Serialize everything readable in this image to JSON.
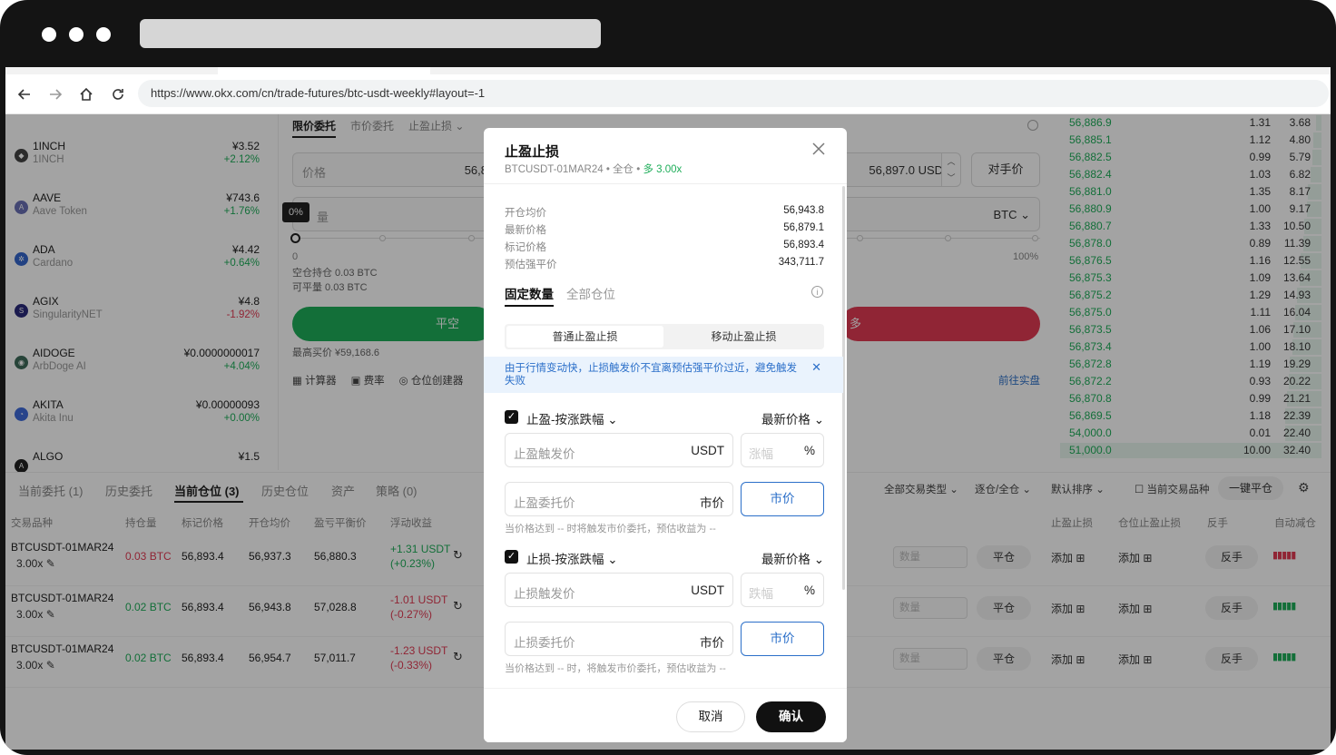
{
  "browser": {
    "url": "https://www.okx.com/cn/trade-futures/btc-usdt-weekly#layout=-1"
  },
  "coins": [
    {
      "symbol": "1INCH",
      "name": "1INCH",
      "price": "¥3.52",
      "change": "+2.12%",
      "dir": "up"
    },
    {
      "symbol": "AAVE",
      "name": "Aave Token",
      "price": "¥743.6",
      "change": "+1.76%",
      "dir": "up"
    },
    {
      "symbol": "ADA",
      "name": "Cardano",
      "price": "¥4.42",
      "change": "+0.64%",
      "dir": "up"
    },
    {
      "symbol": "AGIX",
      "name": "SingularityNET",
      "price": "¥4.8",
      "change": "-1.92%",
      "dir": "down"
    },
    {
      "symbol": "AIDOGE",
      "name": "ArbDoge AI",
      "price": "¥0.0000000017",
      "change": "+4.04%",
      "dir": "up"
    },
    {
      "symbol": "AKITA",
      "name": "Akita Inu",
      "price": "¥0.00000093",
      "change": "+0.00%",
      "dir": "up"
    },
    {
      "symbol": "ALGO",
      "name": "",
      "price": "¥1.5",
      "change": "",
      "dir": "up"
    }
  ],
  "order_panel": {
    "tabs": [
      "限价委托",
      "市价委托",
      "止盈止损"
    ],
    "price_label": "价格",
    "price_value": "56,8",
    "price_right": "56,897.0  USDT",
    "counterparty_btn": "对手价",
    "qty_label": "量",
    "qty_unit": "BTC",
    "slider_tip": "0%",
    "slider_min": "0",
    "slider_max": "100%",
    "avail_open": "空仓持仓 0.03 BTC",
    "avail_close": "可平量 0.03 BTC",
    "close_short_btn": "平空",
    "close_long_btn": "多",
    "max_buy": "最高买价 ¥59,168.6",
    "tools": [
      "计算器",
      "费率",
      "仓位创建器"
    ],
    "goto_live": "前往实盘"
  },
  "order_book": [
    {
      "price": "56,886.9",
      "qty": "1.31",
      "total": "3.68",
      "fill": 0.11
    },
    {
      "price": "56,885.1",
      "qty": "1.12",
      "total": "4.80",
      "fill": 0.15
    },
    {
      "price": "56,882.5",
      "qty": "0.99",
      "total": "5.79",
      "fill": 0.18
    },
    {
      "price": "56,882.4",
      "qty": "1.03",
      "total": "6.82",
      "fill": 0.21
    },
    {
      "price": "56,881.0",
      "qty": "1.35",
      "total": "8.17",
      "fill": 0.25
    },
    {
      "price": "56,880.9",
      "qty": "1.00",
      "total": "9.17",
      "fill": 0.28
    },
    {
      "price": "56,880.7",
      "qty": "1.33",
      "total": "10.50",
      "fill": 0.32
    },
    {
      "price": "56,878.0",
      "qty": "0.89",
      "total": "11.39",
      "fill": 0.35
    },
    {
      "price": "56,876.5",
      "qty": "1.16",
      "total": "12.55",
      "fill": 0.39
    },
    {
      "price": "56,875.3",
      "qty": "1.09",
      "total": "13.64",
      "fill": 0.42
    },
    {
      "price": "56,875.2",
      "qty": "1.29",
      "total": "14.93",
      "fill": 0.46
    },
    {
      "price": "56,875.0",
      "qty": "1.11",
      "total": "16.04",
      "fill": 0.5
    },
    {
      "price": "56,873.5",
      "qty": "1.06",
      "total": "17.10",
      "fill": 0.53
    },
    {
      "price": "56,873.4",
      "qty": "1.00",
      "total": "18.10",
      "fill": 0.56
    },
    {
      "price": "56,872.8",
      "qty": "1.19",
      "total": "19.29",
      "fill": 0.6
    },
    {
      "price": "56,872.2",
      "qty": "0.93",
      "total": "20.22",
      "fill": 0.62
    },
    {
      "price": "56,870.8",
      "qty": "0.99",
      "total": "21.21",
      "fill": 0.66
    },
    {
      "price": "56,869.5",
      "qty": "1.18",
      "total": "22.39",
      "fill": 0.69
    },
    {
      "price": "54,000.0",
      "qty": "0.01",
      "total": "22.40",
      "fill": 0.69
    },
    {
      "price": "51,000.0",
      "qty": "10.00",
      "total": "32.40",
      "fill": 1.0
    }
  ],
  "bottom_tabs": [
    "当前委托 (1)",
    "历史委托",
    "当前仓位 (3)",
    "历史仓位",
    "资产",
    "策略 (0)"
  ],
  "bottom_filters": [
    "全部交易类型",
    "逐仓/全仓",
    "默认排序",
    "当前交易品种",
    "一键平仓"
  ],
  "columns": [
    "交易品种",
    "持仓量",
    "标记价格",
    "开仓均价",
    "盈亏平衡价",
    "浮动收益",
    "止盈止损",
    "仓位止盈止损",
    "反手",
    "自动减仓"
  ],
  "positions": [
    {
      "symbol": "BTCUSDT-01MAR24",
      "lev": "3.00x",
      "size": "0.03 BTC",
      "size_dir": "down",
      "mark": "56,893.4",
      "open": "56,937.3",
      "be": "56,880.3",
      "pnl": "+1.31 USDT",
      "pnl_pct": "(+0.23%)",
      "pnl_dir": "up",
      "close": "平仓",
      "add1": "添加",
      "add2": "添加",
      "rev": "反手",
      "qty_ph": "数量"
    },
    {
      "symbol": "BTCUSDT-01MAR24",
      "lev": "3.00x",
      "size": "0.02 BTC",
      "size_dir": "up",
      "mark": "56,893.4",
      "open": "56,943.8",
      "be": "57,028.8",
      "pnl": "-1.01 USDT",
      "pnl_pct": "(-0.27%)",
      "pnl_dir": "down",
      "close": "平仓",
      "add1": "添加",
      "add2": "添加",
      "rev": "反手",
      "qty_ph": "数量"
    },
    {
      "symbol": "BTCUSDT-01MAR24",
      "lev": "3.00x",
      "size": "0.02 BTC",
      "size_dir": "up",
      "mark": "56,893.4",
      "open": "56,954.7",
      "be": "57,011.7",
      "pnl": "-1.23 USDT",
      "pnl_pct": "(-0.33%)",
      "pnl_dir": "down",
      "close": "平仓",
      "add1": "添加",
      "add2": "添加",
      "rev": "反手",
      "qty_ph": "数量"
    }
  ],
  "modal": {
    "title": "止盈止损",
    "sub_prefix": "BTCUSDT-01MAR24 • 全仓 • ",
    "sub_side": "多 3.00x",
    "info": [
      {
        "k": "开仓均价",
        "v": "56,943.8"
      },
      {
        "k": "最新价格",
        "v": "56,879.1"
      },
      {
        "k": "标记价格",
        "v": "56,893.4"
      },
      {
        "k": "预估强平价",
        "v": "343,711.7"
      }
    ],
    "tab_fixed": "固定数量",
    "tab_all": "全部仓位",
    "seg_normal": "普通止盈止损",
    "seg_trailing": "移动止盈止损",
    "notice": "由于行情变动快，止损触发价不宜离预估强平价过近，避免触发失败",
    "tp_section": "止盈-按涨跌幅",
    "sl_section": "止损-按涨跌幅",
    "price_type": "最新价格",
    "tp_trigger_ph": "止盈触发价",
    "sl_trigger_ph": "止损触发价",
    "unit_usdt": "USDT",
    "pct_ph": "涨幅",
    "pct_ph_sl": "跌幅",
    "pct_unit": "%",
    "tp_order_ph": "止盈委托价",
    "sl_order_ph": "止损委托价",
    "market_label": "市价",
    "market_btn": "市价",
    "tp_hint": "当价格达到 -- 时将触发市价委托，预估收益为 --",
    "sl_hint": "当价格达到 -- 时，将触发市价委托，预估收益为 --",
    "cancel": "取消",
    "confirm": "确认"
  }
}
